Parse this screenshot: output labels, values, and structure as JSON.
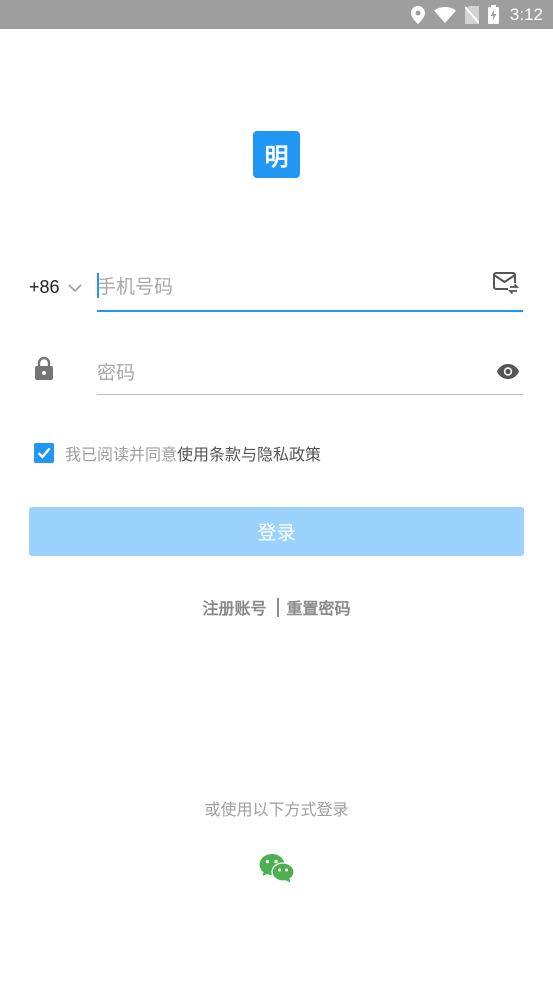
{
  "status_bar": {
    "time": "3:12"
  },
  "logo": {
    "text": "明"
  },
  "phone": {
    "country_code": "+86",
    "placeholder": "手机号码"
  },
  "password": {
    "placeholder": "密码"
  },
  "agreement": {
    "checked": true,
    "prefix": "我已阅读并同意",
    "terms_link": "使用条款与隐私政策"
  },
  "login_button": "登录",
  "links": {
    "register": "注册账号",
    "reset_password": "重置密码"
  },
  "alt_login": {
    "text": "或使用以下方式登录"
  },
  "colors": {
    "accent": "#2196f3",
    "button_disabled": "#9bd2fc",
    "wechat": "#4caf50"
  }
}
